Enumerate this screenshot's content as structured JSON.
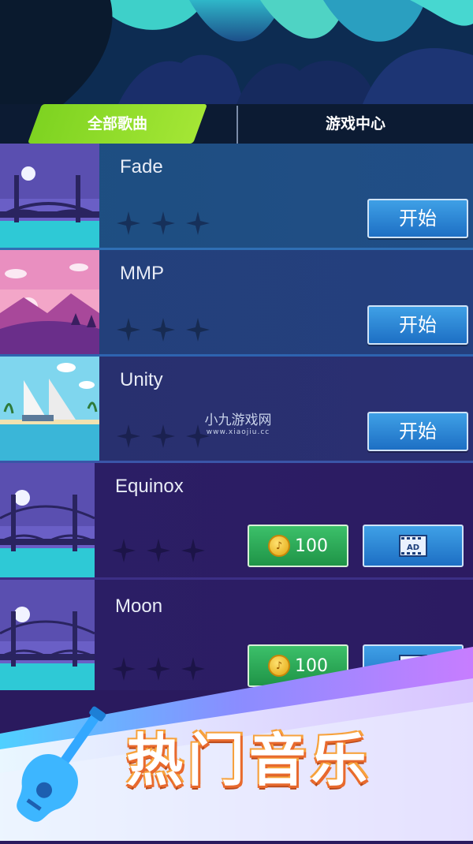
{
  "tabs": [
    {
      "label": "全部歌曲",
      "active": true
    },
    {
      "label": "游戏中心",
      "active": false
    }
  ],
  "songs": [
    {
      "title": "Fade",
      "stars_earned": 0,
      "stars_total": 3,
      "action": "开始",
      "thumbnail": "bridge-night"
    },
    {
      "title": "MMP",
      "stars_earned": 0,
      "stars_total": 3,
      "action": "开始",
      "thumbnail": "pink-sunset-mountains"
    },
    {
      "title": "Unity",
      "stars_earned": 0,
      "stars_total": 3,
      "action": "开始",
      "thumbnail": "sailboat-beach"
    },
    {
      "title": "Equinox",
      "stars_earned": 0,
      "stars_total": 3,
      "price": "100",
      "ad_label": "AD",
      "thumbnail": "bridge-night"
    },
    {
      "title": "Moon",
      "stars_earned": 0,
      "stars_total": 3,
      "price": "100",
      "ad_label": "AD",
      "thumbnail": "bridge-night"
    }
  ],
  "watermark": {
    "name": "小九游戏网",
    "url": "www.xiaojiu.cc"
  },
  "banner": {
    "text": "热门音乐",
    "icon": "guitar-icon"
  },
  "colors": {
    "accent_green": "#8edb2a",
    "button_blue": "#2a86d6",
    "coin_green": "#2ea85a"
  }
}
